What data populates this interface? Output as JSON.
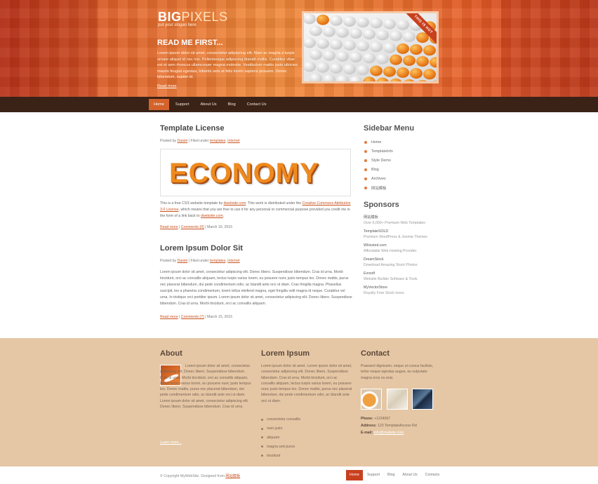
{
  "colors": {
    "accent": "#d3622b",
    "nav_bg": "#3a2217",
    "footer_bg": "#e5c7a5",
    "link": "#c8531f"
  },
  "header": {
    "logo_bold": "BIG",
    "logo_light": "PIXELS",
    "slogan": "put your slogan here",
    "readme_title": "READ ME FIRST...",
    "readme_text": "Lorem ipsum dolor sit amet, consectetur adipiscing elit. Nam ac magna a turpis ornare aliquet id nec nisi. Pellentesque adipiscing blandit mollis. Curabitur vitae est et sem rhoncus ullamcorper magna molestie. Vestibulum mattis justo ultricies mauris feugiat egestas, lobortis sem at felis lorem sapiens posuere. Donec bibendum, sapien id.",
    "readme_more": "Read more",
    "hero_badge": "THIS IS HOT"
  },
  "nav": [
    "Home",
    "Support",
    "About Us",
    "Blog",
    "Contact Us"
  ],
  "posts": [
    {
      "title": "Template License",
      "posted_by": "Posted by",
      "author": "Daniel",
      "filed_under": "| Filed under",
      "cat1": "templates",
      "cat2": "internet",
      "image_word": "ECONOMY",
      "text_pre": "This is a free CSS website template by",
      "text_link1": "dwebsite.com",
      "text_mid": ". This work is distributed under the",
      "text_link2": "Creative Commons Attribution 3.0 License",
      "text_post": ", which means that you are free to use it for any personal or commercial purpose provided you credit me in the form of a link back to",
      "text_link3": "dwebsite.com",
      "read_more": "Read more",
      "comments": "Comments (0)",
      "date": "| March 16, 2015"
    },
    {
      "title": "Lorem Ipsum Dolor Sit",
      "posted_by": "Posted by",
      "author": "Daniel",
      "filed_under": "| Filed under",
      "cat1": "templates",
      "cat2": "internet",
      "text": "Lorem ipsum dolor sit amet, consectetur adipiscing elit. Donec libero. Suspendisse bibendum. Cras id urna. Morbi tincidunt, orci ac convallis aliquam, lectus turpis varius lorem, eu posuere nunc justo tempus leo. Donec mattis, purus nec placerat bibendum, dui pede condimentum odio, ac blandit ante orci ut diam. Cras fringilla magna. Phasellus suscipit, leo a pharetra condimentum, lorem tellus eleifend magna, eget fringilla velit magna id neque. Curabitur vel urna. In tristique orci porttitor ipsum. Lorem ipsum dolor sit amet, consectetur adipiscing elit. Donec libero. Suspendisse bibendum. Cras id urna. Morbi tincidunt, orci ac convallis aliquam.",
      "read_more": "Read more",
      "comments": "Comments (7)",
      "date": "| March 15, 2015"
    }
  ],
  "sidebar": {
    "menu_title": "Sidebar Menu",
    "menu": [
      "Home",
      "TemplateInfo",
      "Style Demo",
      "Blog",
      "Archives",
      "网站模板"
    ],
    "sponsors_title": "Sponsors",
    "sponsors": [
      {
        "name": "网站模板",
        "desc": "Over 6,000+ Premium Web Templates"
      },
      {
        "name": "TemplateSOLD",
        "desc": "Premium WordPress & Joomla Themes"
      },
      {
        "name": "WHosted.com",
        "desc": "Affordable Web Hosting Provider"
      },
      {
        "name": "DreamStock",
        "desc": "Download Amazing Stock Photos"
      },
      {
        "name": "Evrsoft",
        "desc": "Website Builder Software & Tools"
      },
      {
        "name": "MyVectorStore",
        "desc": "Royalty Free Stock Icons"
      }
    ]
  },
  "footer": {
    "about_title": "About",
    "about_text": "Lorem ipsum dolor sit amet, consectetur adipiscing elit. Donec libero. Suspendisse bibendum. Cras id urna. Morbi tincidunt, orci ac convallis aliquam, lectus turpis varius lorem, eu posuere nunc justo tempus leo. Donec mattis, purus nec placerat bibendum, dui pede condimentum odio, ac blandit ante orci ut diam. Lorem ipsum dolor sit amet, consectetur adipiscing elit. Donec libero. Suspendisse bibendum. Cras id urna.",
    "about_more": "Learn more...",
    "lorem_title": "Lorem Ipsum",
    "lorem_text": "Lorem ipsum dolor sit amet. Lorem ipsum dolor sit amet, consectetur adipiscing elit. Donec libero. Suspendisse bibendum. Cras id urna. Morbi tincidunt, orci ac convallis aliquam, lectus turpis varius lorem, eu posuere nunc justo tempus leo. Donec mattis, purus nec placerat bibendum, dui pede condimentum odio, ac blandit ante orci ut diam.",
    "lorem_list": [
      "consectetur convallis",
      "nam justo",
      "aliquam",
      "magna sed purus",
      "tincidunt"
    ],
    "contact_title": "Contact",
    "contact_text": "Praesent dignissim, neque ut cursus facilisis, tortor neque egestas augue, eu vulputate magna eros eu erat.",
    "phone_label": "Phone:",
    "phone": "+1234567",
    "address_label": "Address:",
    "address": "123 TemplateAccess Rd",
    "email_label": "E-mail:",
    "email": "info@mailsite.com"
  },
  "bottom": {
    "copyright": "© Copyright MyWebSite. Designed from",
    "copyright_link": "网站模板",
    "nav": [
      "Home",
      "Support",
      "Blog",
      "About Us",
      "Contacts"
    ]
  }
}
